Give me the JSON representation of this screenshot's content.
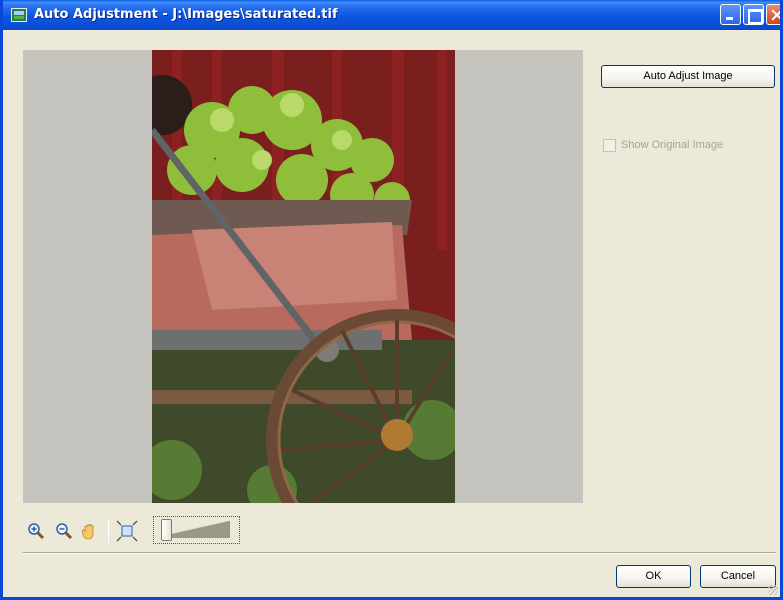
{
  "window": {
    "title": "Auto Adjustment - J:\\Images\\saturated.tif",
    "icon": "image-app-icon",
    "controls": [
      "minimize-icon",
      "maximize-icon",
      "close-icon"
    ]
  },
  "sidebar": {
    "auto_adjust_label": "Auto Adjust Image",
    "show_original_label": "Show Original Image",
    "show_original_checked": false,
    "show_original_enabled": false
  },
  "toolbar": {
    "tools": [
      "zoom-in-icon",
      "zoom-out-icon",
      "hand-pan-icon",
      "fit-to-window-icon"
    ],
    "zoom_slider_level": 0.05
  },
  "footer": {
    "ok_label": "OK",
    "cancel_label": "Cancel"
  },
  "colors": {
    "titlebar": "#0b55e0",
    "dialog_bg": "#ece9d8",
    "preview_bg": "#c5c4be",
    "close_button": "#d2461e"
  }
}
